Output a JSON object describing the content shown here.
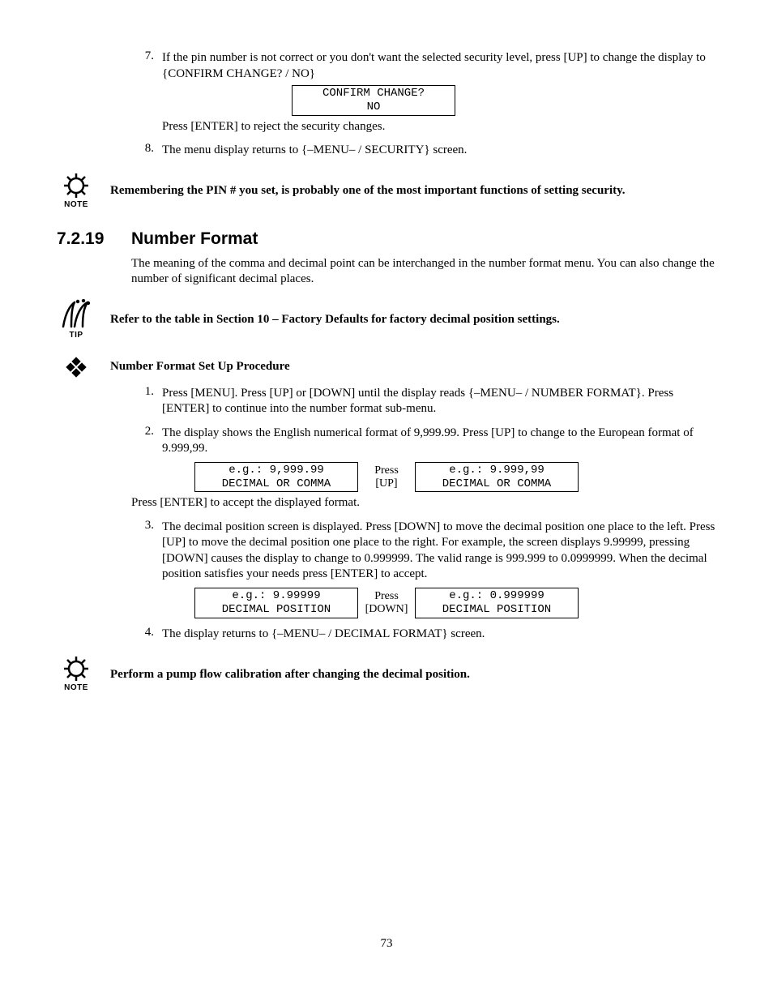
{
  "list1": {
    "item7": {
      "num": "7.",
      "text": "If the pin number is not correct or you don't want the selected security level, press [UP] to change the display to {CONFIRM CHANGE? / NO}",
      "box_line1": "CONFIRM CHANGE?",
      "box_line2": "NO",
      "after_box": "Press [ENTER] to reject the security changes."
    },
    "item8": {
      "num": "8.",
      "text": "The menu display returns to {–MENU– / SECURITY} screen."
    }
  },
  "note1": {
    "label": "NOTE",
    "text": "Remembering the PIN # you set, is probably one of the most important functions of setting security."
  },
  "heading": {
    "num": "7.2.19",
    "title": "Number Format"
  },
  "intro": "The meaning of the comma and decimal point can be interchanged in the number format menu.  You can also change the number of significant decimal places.",
  "tip1": {
    "label": "TIP",
    "text": "Refer to the table in Section 10 – Factory Defaults for factory decimal position settings."
  },
  "procedure_title": "Number Format Set Up Procedure",
  "list2": {
    "item1": {
      "num": "1.",
      "text": "Press [MENU].  Press [UP] or [DOWN] until the display reads {–MENU– / NUMBER FORMAT}.  Press [ENTER] to continue into the number format sub-menu."
    },
    "item2": {
      "num": "2.",
      "text": "The display shows the English numerical format of 9,999.99.  Press [UP] to change to the European format of 9.999,99.",
      "boxA_line1": "e.g.: 9,999.99",
      "boxA_line2": "DECIMAL OR COMMA",
      "mid_top": "Press",
      "mid_bot": "[UP]",
      "boxB_line1": "e.g.: 9.999,99",
      "boxB_line2": "DECIMAL OR COMMA",
      "after": "Press [ENTER] to accept the displayed format."
    },
    "item3": {
      "num": "3.",
      "text": "The decimal position screen is displayed.  Press [DOWN] to move the decimal position one place to the left.  Press [UP] to move the decimal position one place to the right.  For example, the screen displays 9.99999, pressing [DOWN] causes the display to change to 0.999999.  The valid range is 999.999 to 0.0999999.  When the decimal position satisfies your needs press [ENTER] to accept.",
      "boxA_line1": "e.g.: 9.99999",
      "boxA_line2": "DECIMAL POSITION",
      "mid_top": "Press",
      "mid_bot": "[DOWN]",
      "boxB_line1": "e.g.: 0.999999",
      "boxB_line2": "DECIMAL POSITION"
    },
    "item4": {
      "num": "4.",
      "text": "The display returns to {–MENU– / DECIMAL FORMAT} screen."
    }
  },
  "note2": {
    "label": "NOTE",
    "text": "Perform a pump flow calibration after changing the decimal position."
  },
  "page_number": "73"
}
